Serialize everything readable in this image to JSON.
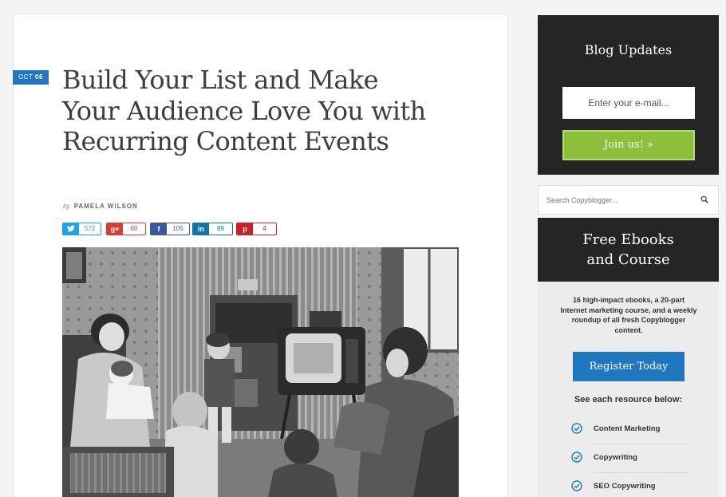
{
  "article": {
    "date_month": "OCT",
    "date_day": "08",
    "title": "Build Your List and Make Your Audience Love You with Recurring Content Events",
    "byline_prefix": "by",
    "author": "PAMELA WILSON",
    "shares": [
      {
        "network": "twitter",
        "icon": "twitter-icon",
        "glyph": "t",
        "count": "572",
        "color": "#1da1f2"
      },
      {
        "network": "google-plus",
        "icon": "google-plus-icon",
        "glyph": "g+",
        "count": "60",
        "color": "#d73d32"
      },
      {
        "network": "facebook",
        "icon": "facebook-icon",
        "glyph": "f",
        "count": "105",
        "color": "#3b5998"
      },
      {
        "network": "linkedin",
        "icon": "linkedin-icon",
        "glyph": "in",
        "count": "89",
        "color": "#0e76a8"
      },
      {
        "network": "pinterest",
        "icon": "pinterest-icon",
        "glyph": "p",
        "count": "4",
        "color": "#cb2027"
      }
    ]
  },
  "sidebar": {
    "blog_updates_title": "Blog Updates",
    "email_placeholder": "Enter your e-mail...",
    "join_label": "Join us! »",
    "search_placeholder": "Search Copyblogger...",
    "ebooks_title_line1": "Free Ebooks",
    "ebooks_title_line2": "and Course",
    "ebooks_description": "16 high-impact ebooks, a 20-part Internet marketing course, and a weekly roundup of all fresh Copyblogger content.",
    "register_label": "Register Today",
    "see_label": "See each resource below:",
    "resources": [
      "Content Marketing",
      "Copywriting",
      "SEO Copywriting"
    ]
  },
  "colors": {
    "accent_blue": "#1f77c2",
    "join_green": "#8cbf3a",
    "dark_panel": "#252525"
  }
}
